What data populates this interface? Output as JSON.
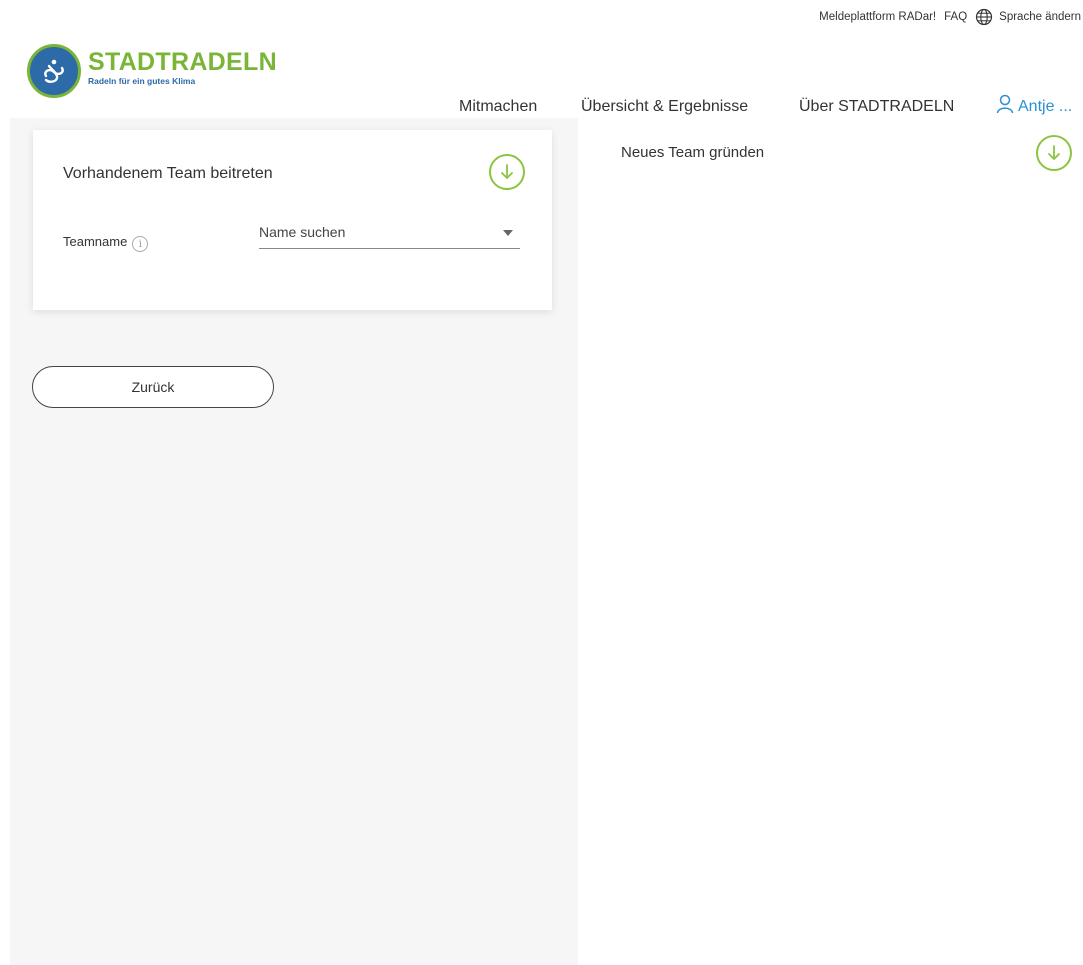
{
  "topbar": {
    "report_link": "Meldeplattform RADar!",
    "faq_link": "FAQ",
    "language_label": "Sprache ändern"
  },
  "brand": {
    "title": "STADTRADELN",
    "subtitle": "Radeln für ein gutes Klima",
    "green": "#7bb538",
    "blue": "#2d6aa8"
  },
  "nav": {
    "items": [
      {
        "label": "Mitmachen"
      },
      {
        "label": "Übersicht & Ergebnisse"
      },
      {
        "label": "Über STADTRADELN"
      }
    ],
    "user_label": "Antje ...",
    "user_icon": "user-icon",
    "user_color": "#2a8fd6"
  },
  "join_team": {
    "title": "Vorhandenem Team beitreten",
    "field_label": "Teamname",
    "select_value": "Name suchen",
    "toggle_icon": "arrow-down-circle-icon"
  },
  "back_button": {
    "label": "Zurück"
  },
  "new_team": {
    "title": "Neues Team gründen",
    "toggle_icon": "arrow-down-circle-icon"
  }
}
